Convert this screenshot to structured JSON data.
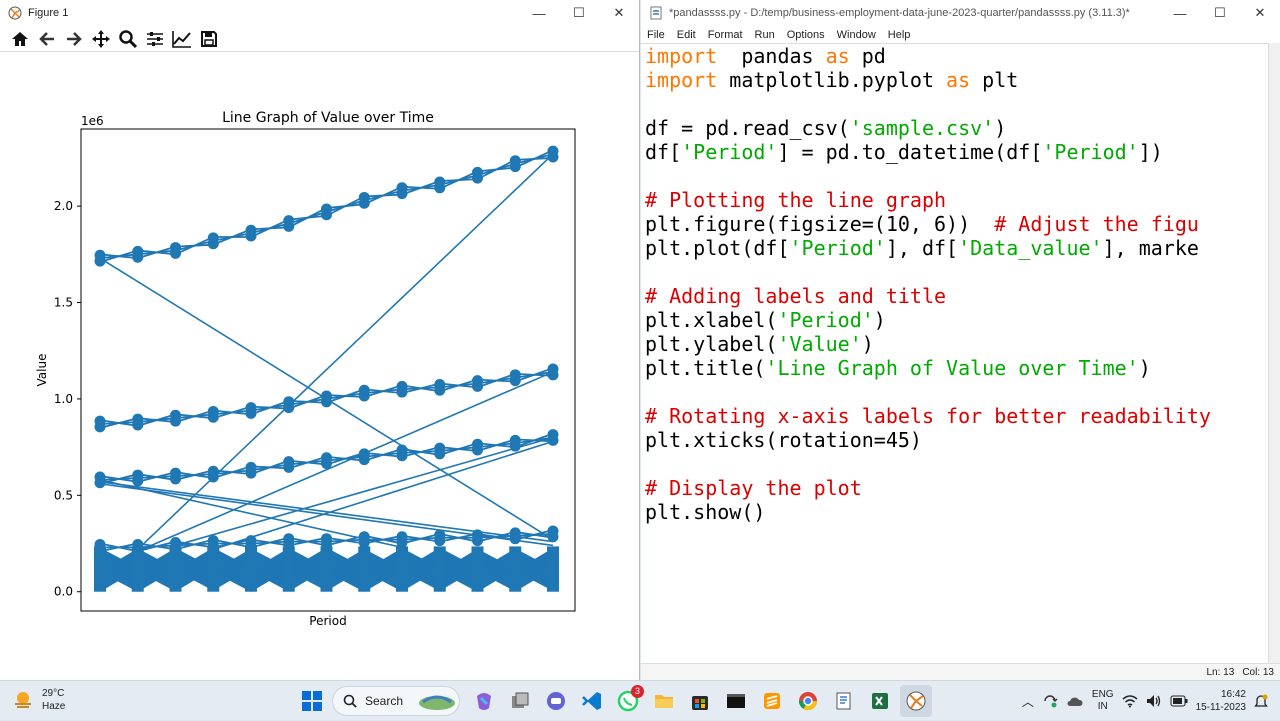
{
  "figure_window": {
    "title": "Figure 1",
    "toolbar": [
      "home-icon",
      "back-icon",
      "forward-icon",
      "pan-icon",
      "zoom-icon",
      "configure-icon",
      "edit-axis-icon",
      "save-icon"
    ]
  },
  "chart_data": {
    "type": "line",
    "title": "Line Graph of Value over Time",
    "xlabel": "Period",
    "ylabel": "Value",
    "offset_label": "1e6",
    "ytick_labels": [
      "0.0",
      "0.5",
      "1.0",
      "1.5",
      "2.0"
    ],
    "yticks": [
      0,
      0.5,
      1.0,
      1.5,
      2.0
    ],
    "ylim": [
      -0.1,
      2.4
    ],
    "x_points": 12,
    "color": "#1f77b4",
    "series": [
      {
        "values": [
          1.73,
          1.75,
          1.77,
          1.82,
          1.86,
          1.91,
          1.97,
          2.03,
          2.08,
          2.11,
          2.16,
          2.22,
          2.27
        ]
      },
      {
        "values": [
          0.87,
          0.88,
          0.9,
          0.92,
          0.94,
          0.97,
          1.0,
          1.03,
          1.05,
          1.06,
          1.08,
          1.11,
          1.14
        ]
      },
      {
        "values": [
          0.58,
          0.59,
          0.6,
          0.61,
          0.63,
          0.66,
          0.68,
          0.7,
          0.72,
          0.73,
          0.75,
          0.77,
          0.8
        ]
      },
      {
        "values": [
          0.23,
          0.23,
          0.24,
          0.25,
          0.25,
          0.26,
          0.26,
          0.27,
          0.27,
          0.28,
          0.28,
          0.29,
          0.3
        ]
      }
    ]
  },
  "idle_window": {
    "title": "*pandassss.py - D:/temp/business-employment-data-june-2023-quarter/pandassss.py (3.11.3)*",
    "menu": [
      "File",
      "Edit",
      "Format",
      "Run",
      "Options",
      "Window",
      "Help"
    ],
    "status": {
      "line": "Ln: 13",
      "col": "Col: 13"
    },
    "code": [
      [
        [
          "kw",
          "import"
        ],
        [
          "",
          "  pandas "
        ],
        [
          "kw",
          "as"
        ],
        [
          "",
          " pd"
        ]
      ],
      [
        [
          "kw",
          "import"
        ],
        [
          "",
          " matplotlib.pyplot "
        ],
        [
          "kw",
          "as"
        ],
        [
          "",
          " plt"
        ]
      ],
      [],
      [
        [
          "",
          "df = pd.read_csv("
        ],
        [
          "str",
          "'sample.csv'"
        ],
        [
          "",
          ")"
        ]
      ],
      [
        [
          "",
          "df["
        ],
        [
          "str",
          "'Period'"
        ],
        [
          "",
          "] = pd.to_datetime(df["
        ],
        [
          "str",
          "'Period'"
        ],
        [
          "",
          "])"
        ]
      ],
      [],
      [
        [
          "cm",
          "# Plotting the line graph"
        ]
      ],
      [
        [
          "",
          "plt.figure(figsize=(10, 6))  "
        ],
        [
          "cm",
          "# Adjust the figu"
        ]
      ],
      [
        [
          "",
          "plt.plot(df["
        ],
        [
          "str",
          "'Period'"
        ],
        [
          "",
          "], df["
        ],
        [
          "str",
          "'Data_value'"
        ],
        [
          "",
          "], marke"
        ]
      ],
      [],
      [
        [
          "cm",
          "# Adding labels and title"
        ]
      ],
      [
        [
          "",
          "plt.xlabel("
        ],
        [
          "str",
          "'Period'"
        ],
        [
          "",
          ")"
        ]
      ],
      [
        [
          "",
          "plt.ylabel("
        ],
        [
          "str",
          "'Value'"
        ],
        [
          "",
          ")"
        ]
      ],
      [
        [
          "",
          "plt.title("
        ],
        [
          "str",
          "'Line Graph of Value over Time'"
        ],
        [
          "",
          ")"
        ]
      ],
      [],
      [
        [
          "cm",
          "# Rotating x-axis labels for better readability"
        ]
      ],
      [
        [
          "",
          "plt.xticks(rotation=45)"
        ]
      ],
      [],
      [
        [
          "cm",
          "# Display the plot"
        ]
      ],
      [
        [
          "",
          "plt.show()"
        ]
      ]
    ]
  },
  "taskbar": {
    "weather_temp": "29°C",
    "weather_desc": "Haze",
    "search_label": "Search",
    "whatsapp_badge": "3",
    "lang_top": "ENG",
    "lang_bottom": "IN",
    "time": "16:42",
    "date": "15-11-2023"
  }
}
